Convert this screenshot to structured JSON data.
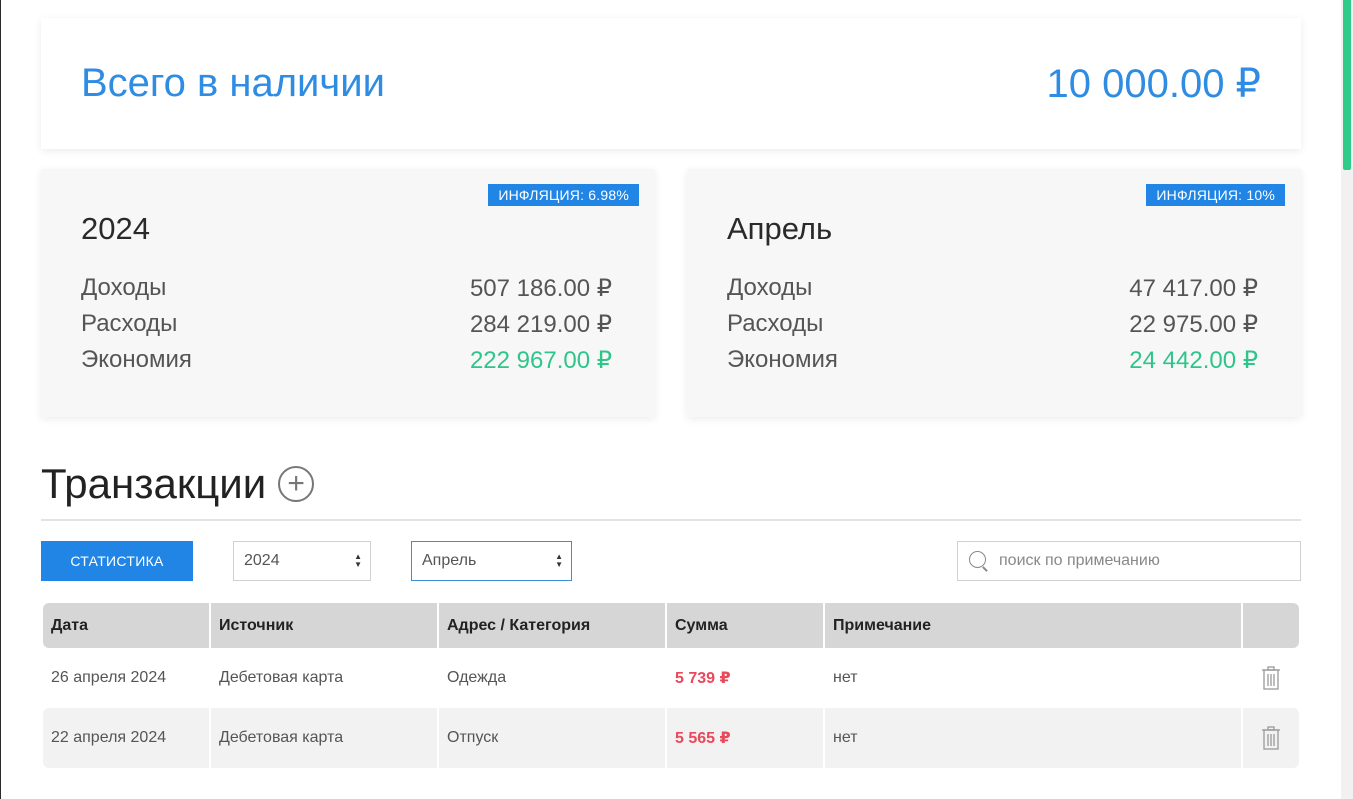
{
  "total": {
    "title": "Всего в наличии",
    "amount": "10 000.00 ₽"
  },
  "year_summary": {
    "badge": "ИНФЛЯЦИЯ: 6.98%",
    "heading": "2024",
    "rows": [
      {
        "label": "Доходы",
        "value": "507 186.00 ₽"
      },
      {
        "label": "Расходы",
        "value": "284 219.00 ₽"
      },
      {
        "label": "Экономия",
        "value": "222 967.00 ₽"
      }
    ]
  },
  "month_summary": {
    "badge": "ИНФЛЯЦИЯ: 10%",
    "heading": "Апрель",
    "rows": [
      {
        "label": "Доходы",
        "value": "47 417.00 ₽"
      },
      {
        "label": "Расходы",
        "value": "22 975.00 ₽"
      },
      {
        "label": "Экономия",
        "value": "24 442.00 ₽"
      }
    ]
  },
  "transactions": {
    "title": "Транзакции",
    "add_label": "+",
    "stats_button": "СТАТИСТИКА",
    "year_select": "2024",
    "month_select": "Апрель",
    "search_placeholder": "поиск по примечанию",
    "columns": [
      "Дата",
      "Источник",
      "Адрес / Категория",
      "Сумма",
      "Примечание",
      ""
    ],
    "rows": [
      {
        "date": "26 апреля 2024",
        "source": "Дебетовая карта",
        "category": "Одежда",
        "amount": "5 739 ₽",
        "note": "нет"
      },
      {
        "date": "22 апреля 2024",
        "source": "Дебетовая карта",
        "category": "Отпуск",
        "amount": "5 565 ₽",
        "note": "нет"
      }
    ]
  },
  "colors": {
    "accent": "#2185e6",
    "positive": "#2ec58a",
    "negative": "#e8495b",
    "scroll_thumb": "#2ecc88"
  }
}
